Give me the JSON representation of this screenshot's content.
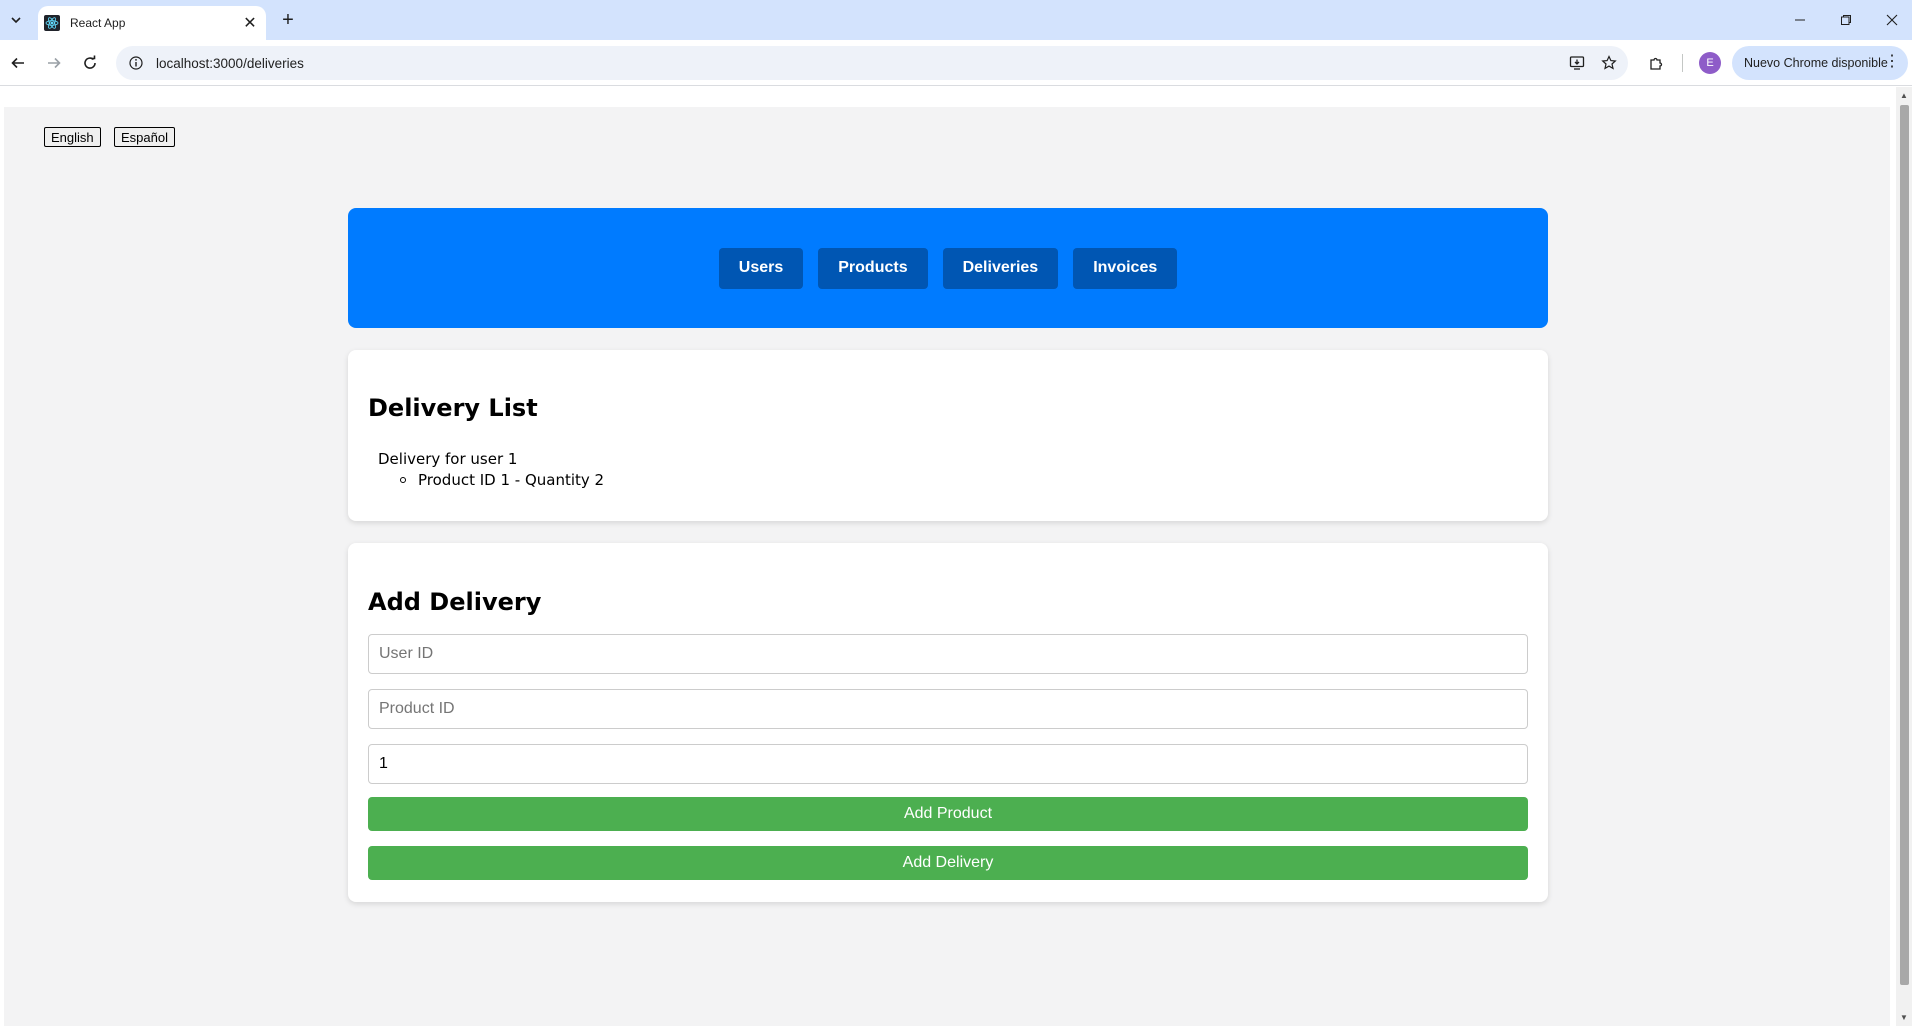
{
  "browser": {
    "tab_title": "React App",
    "url": "localhost:3000/deliveries",
    "profile_initial": "E",
    "update_label": "Nuevo Chrome disponible"
  },
  "languages": [
    "English",
    "Español"
  ],
  "nav": {
    "items": [
      "Users",
      "Products",
      "Deliveries",
      "Invoices"
    ]
  },
  "delivery_list": {
    "heading": "Delivery List",
    "deliveries": [
      {
        "label": "Delivery for user 1",
        "products": [
          "Product ID 1 - Quantity 2"
        ]
      }
    ]
  },
  "add_delivery": {
    "heading": "Add Delivery",
    "user_id_placeholder": "User ID",
    "product_id_placeholder": "Product ID",
    "quantity_value": "1",
    "add_product_label": "Add Product",
    "add_delivery_label": "Add Delivery"
  },
  "colors": {
    "navbar": "#007bff",
    "nav_button": "#0056b3",
    "action_button": "#4caf50",
    "page_bg": "#f3f3f4"
  }
}
